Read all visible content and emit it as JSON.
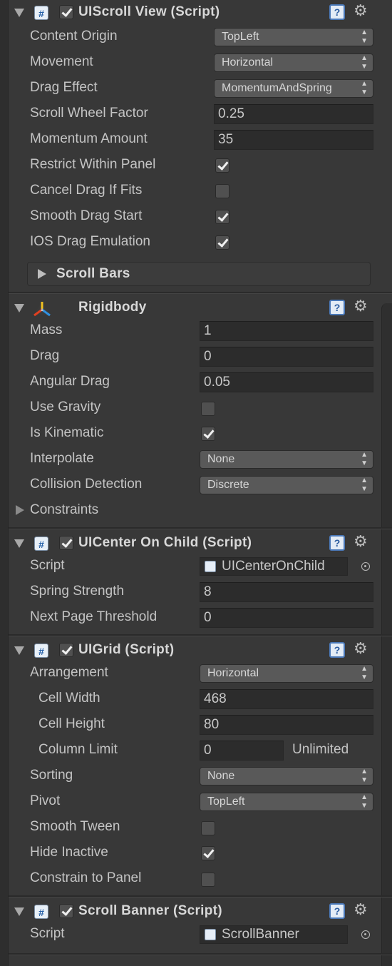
{
  "scroll_view": {
    "title": "UIScroll View (Script)",
    "fields": [
      {
        "label": "Content Origin",
        "type": "popup",
        "value": "TopLeft"
      },
      {
        "label": "Movement",
        "type": "popup",
        "value": "Horizontal"
      },
      {
        "label": "Drag Effect",
        "type": "popup",
        "value": "MomentumAndSpring"
      },
      {
        "label": "Scroll Wheel Factor",
        "type": "text",
        "value": "0.25"
      },
      {
        "label": "Momentum Amount",
        "type": "text",
        "value": "35"
      },
      {
        "label": "Restrict Within Panel",
        "type": "checkbox",
        "checked": true
      },
      {
        "label": "Cancel Drag If Fits",
        "type": "checkbox",
        "checked": false
      },
      {
        "label": "Smooth Drag Start",
        "type": "checkbox",
        "checked": true
      },
      {
        "label": "IOS Drag Emulation",
        "type": "checkbox",
        "checked": true
      }
    ],
    "scroll_bars_label": "Scroll Bars"
  },
  "rigidbody": {
    "title": "Rigidbody",
    "fields": [
      {
        "label": "Mass",
        "type": "text",
        "value": "1"
      },
      {
        "label": "Drag",
        "type": "text",
        "value": "0"
      },
      {
        "label": "Angular Drag",
        "type": "text",
        "value": "0.05"
      },
      {
        "label": "Use Gravity",
        "type": "checkbox",
        "checked": false
      },
      {
        "label": "Is Kinematic",
        "type": "checkbox",
        "checked": true
      },
      {
        "label": "Interpolate",
        "type": "popup",
        "value": "None"
      },
      {
        "label": "Collision Detection",
        "type": "popup",
        "value": "Discrete"
      }
    ],
    "constraints_label": "Constraints"
  },
  "center_on_child": {
    "title": "UICenter On Child (Script)",
    "script_label": "Script",
    "script_value": "UICenterOnChild",
    "fields": [
      {
        "label": "Spring Strength",
        "type": "text",
        "value": "8"
      },
      {
        "label": "Next Page Threshold",
        "type": "text",
        "value": "0"
      }
    ]
  },
  "grid": {
    "title": "UIGrid (Script)",
    "arrangement_label": "Arrangement",
    "arrangement_value": "Horizontal",
    "cell_width_label": "Cell Width",
    "cell_width_value": "468",
    "cell_height_label": "Cell Height",
    "cell_height_value": "80",
    "column_limit_label": "Column Limit",
    "column_limit_value": "0",
    "column_limit_note": "Unlimited",
    "sorting_label": "Sorting",
    "sorting_value": "None",
    "pivot_label": "Pivot",
    "pivot_value": "TopLeft",
    "smooth_tween_label": "Smooth Tween",
    "smooth_tween_checked": false,
    "hide_inactive_label": "Hide Inactive",
    "hide_inactive_checked": true,
    "constrain_label": "Constrain to Panel",
    "constrain_checked": false
  },
  "scroll_banner": {
    "title": "Scroll Banner (Script)",
    "script_label": "Script",
    "script_value": "ScrollBanner"
  },
  "icons": {
    "help": "help-book-icon",
    "settings": "gear-icon",
    "script": "csharp-script-icon",
    "rigidbody": "rigidbody-axes-icon",
    "picker": "object-picker-icon"
  },
  "colors": {
    "background": "#383838",
    "field_bg": "#2c2c2c",
    "popup_bg": "#595959",
    "help_blue": "#4a78b8"
  }
}
